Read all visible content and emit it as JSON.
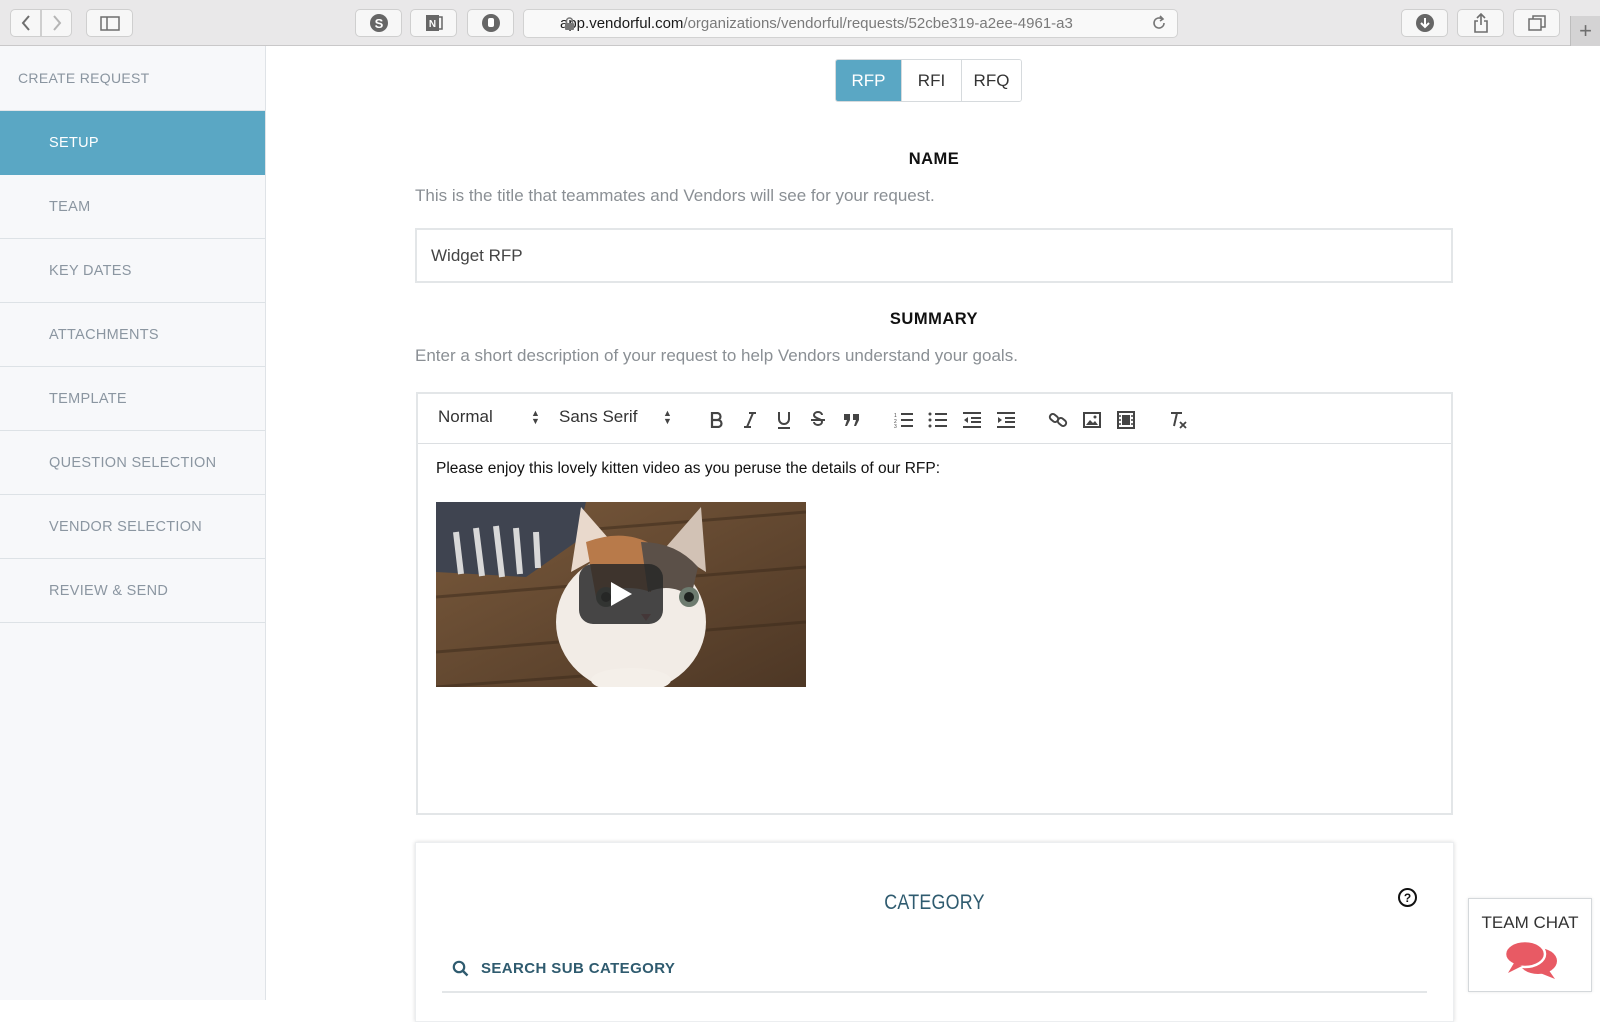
{
  "browser": {
    "url_host": "app.vendorful.com",
    "url_path": "/organizations/vendorful/requests/52cbe319-a2ee-4961-a3"
  },
  "sidebar": {
    "heading": "CREATE REQUEST",
    "items": [
      {
        "label": "SETUP",
        "active": true
      },
      {
        "label": "TEAM"
      },
      {
        "label": "KEY DATES"
      },
      {
        "label": "ATTACHMENTS"
      },
      {
        "label": "TEMPLATE"
      },
      {
        "label": "QUESTION SELECTION"
      },
      {
        "label": "VENDOR SELECTION"
      },
      {
        "label": "REVIEW & SEND"
      }
    ]
  },
  "request_types": {
    "tabs": [
      "RFP",
      "RFI",
      "RFQ"
    ],
    "selected": "RFP"
  },
  "name_section": {
    "title": "NAME",
    "help": "This is the title that teammates and Vendors will see for your request.",
    "value": "Widget RFP"
  },
  "summary_section": {
    "title": "SUMMARY",
    "help": "Enter a short description of your request to help Vendors understand your goals.",
    "format_select": "Normal",
    "font_select": "Sans Serif",
    "body_text": "Please enjoy this lovely kitten video as you peruse the details of our RFP:"
  },
  "category_section": {
    "title": "CATEGORY",
    "search_label": "SEARCH SUB CATEGORY"
  },
  "team_chat": {
    "label": "TEAM CHAT"
  },
  "colors": {
    "accent": "#5aa7c4",
    "category_text": "#2f5b6f",
    "chat_icon": "#e85a64"
  }
}
